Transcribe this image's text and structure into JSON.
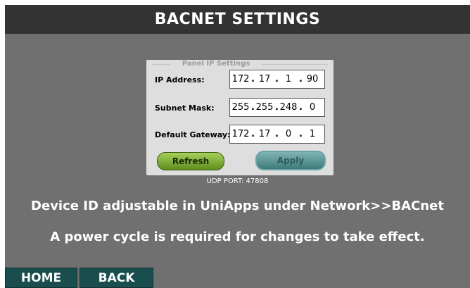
{
  "header": {
    "title": "BACNET SETTINGS"
  },
  "panel": {
    "legend": "Panel IP Settings",
    "fields": [
      {
        "label": "IP Address:",
        "octets": [
          "172",
          "17",
          "1",
          "90"
        ]
      },
      {
        "label": "Subnet Mask:",
        "octets": [
          "255",
          "255",
          "248",
          "0"
        ]
      },
      {
        "label": "Default Gateway:",
        "octets": [
          "172",
          "17",
          "0",
          "1"
        ]
      }
    ],
    "separator": ".",
    "refresh_label": "Refresh",
    "apply_label": "Apply"
  },
  "udp_port": "UDP PORT: 47808",
  "messages": {
    "device_id": "Device ID adjustable in UniApps under Network>>BACnet",
    "power_cycle": "A power cycle is required for changes to take effect."
  },
  "nav": {
    "home_label": "HOME",
    "back_label": "BACK"
  },
  "colors": {
    "screen_bg": "#707070",
    "title_bar": "#333333",
    "panel_bg": "#dedede",
    "refresh_green": "#7fae3a",
    "apply_teal": "#5f9595",
    "nav_bg": "#1a4d4d"
  }
}
